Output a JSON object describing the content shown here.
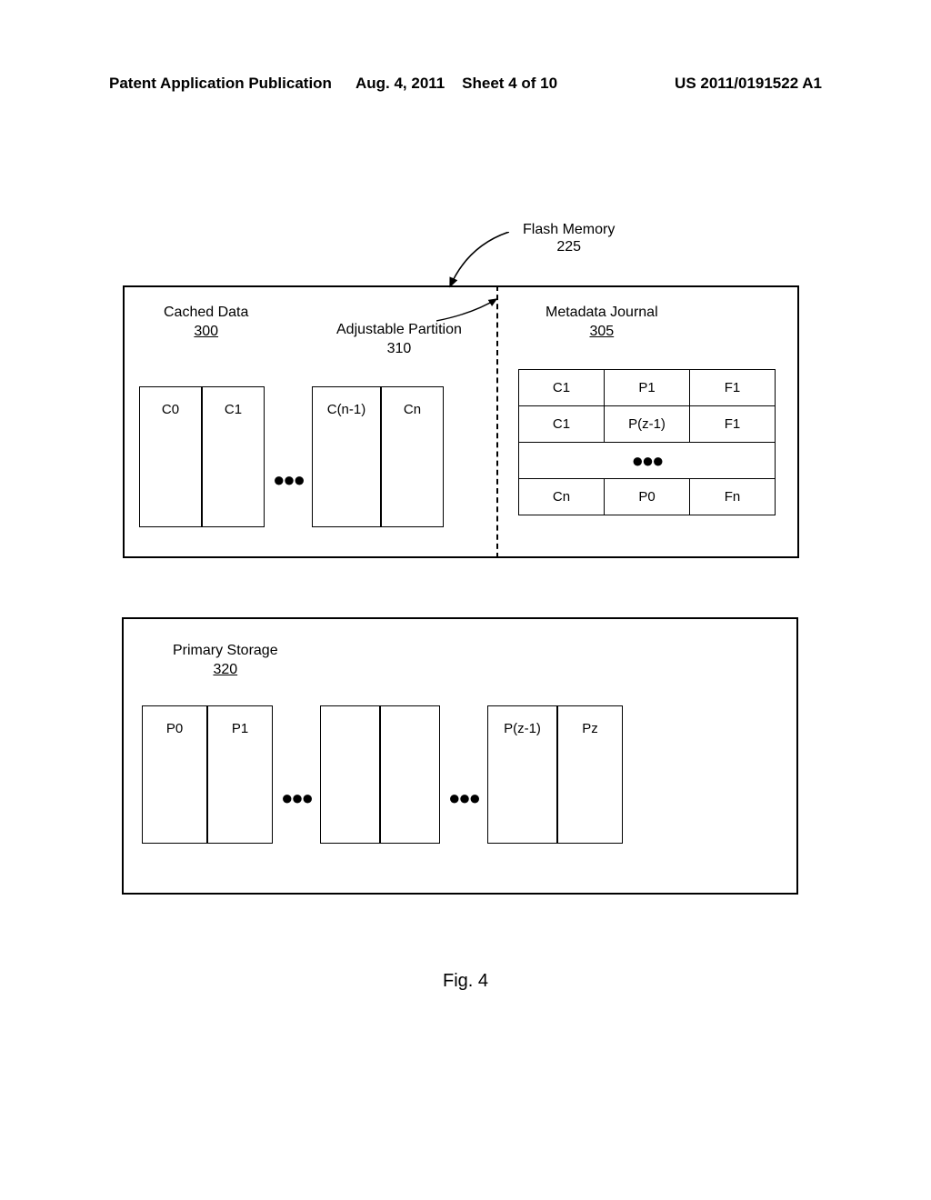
{
  "header": {
    "left": "Patent Application Publication",
    "date": "Aug. 4, 2011",
    "sheet": "Sheet 4 of 10",
    "pubno": "US 2011/0191522 A1"
  },
  "flash": {
    "title": "Flash Memory",
    "ref": "225"
  },
  "cached": {
    "title": "Cached Data",
    "ref": "300"
  },
  "adjpart": {
    "title": "Adjustable Partition",
    "ref": "310"
  },
  "metajournal": {
    "title": "Metadata Journal",
    "ref": "305"
  },
  "cache_cells": {
    "c0": "C0",
    "c1": "C1",
    "cn1": "C(n-1)",
    "cn": "Cn",
    "ellipsis": "●●●"
  },
  "meta_table": {
    "r0": {
      "a": "C1",
      "b": "P1",
      "c": "F1"
    },
    "r1": {
      "a": "C1",
      "b": "P(z-1)",
      "c": "F1"
    },
    "ellipsis": "●●●",
    "rN": {
      "a": "Cn",
      "b": "P0",
      "c": "Fn"
    }
  },
  "primary": {
    "title": "Primary Storage",
    "ref": "320",
    "cells": {
      "p0": "P0",
      "p1": "P1",
      "pz1": "P(z-1)",
      "pz": "Pz",
      "ellipsis": "●●●"
    }
  },
  "caption": "Fig. 4"
}
